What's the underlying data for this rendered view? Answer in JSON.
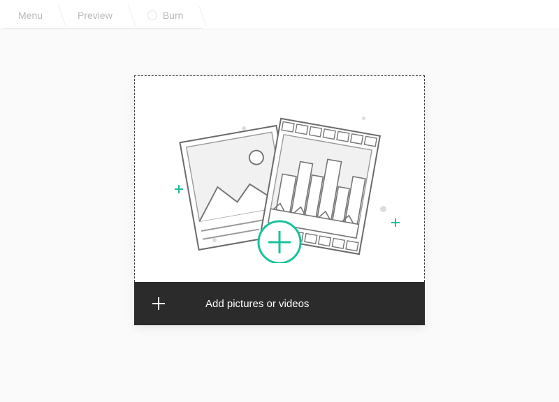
{
  "tabs": [
    {
      "label": "Menu"
    },
    {
      "label": "Preview"
    },
    {
      "label": "Burn"
    }
  ],
  "addbar": {
    "label": "Add pictures or videos"
  },
  "accent": "#17c39b"
}
